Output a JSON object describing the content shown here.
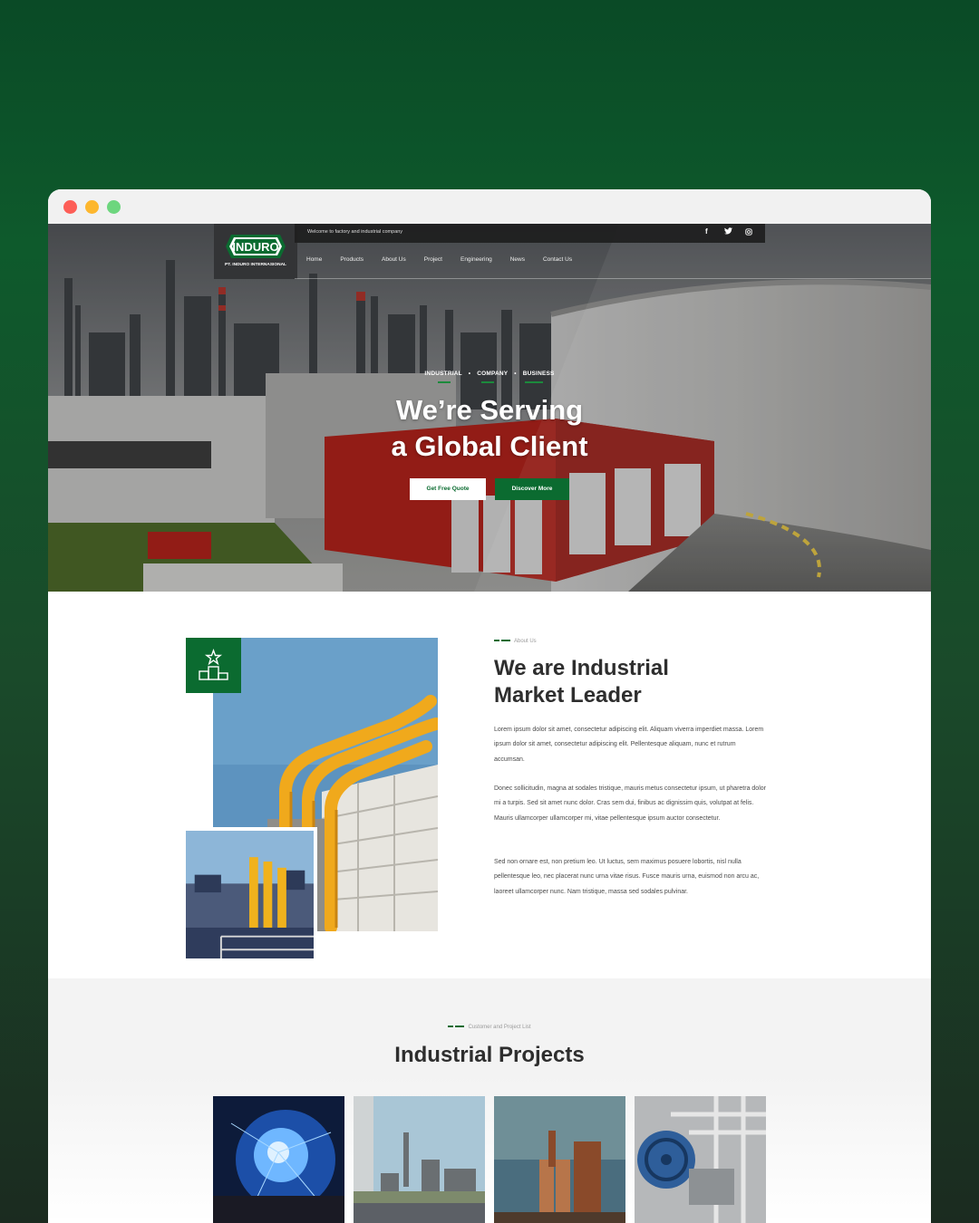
{
  "browser": {
    "controls": [
      "close",
      "minimize",
      "maximize"
    ]
  },
  "topbar": {
    "welcome": "Welcome to factory and industrial company",
    "social": [
      {
        "icon": "facebook-icon",
        "glyph": "f"
      },
      {
        "icon": "twitter-icon",
        "glyph": "🐦"
      },
      {
        "icon": "instagram-icon",
        "glyph": "◎"
      }
    ]
  },
  "logo": {
    "name": "INDURO",
    "company": "PT. INDURO INTERNASIONAL"
  },
  "nav": {
    "items": [
      "Home",
      "Products",
      "About Us",
      "Project",
      "Engineering",
      "News",
      "Contact Us"
    ]
  },
  "hero": {
    "tags": [
      "INDUSTRIAL",
      "COMPANY",
      "BUSINESS"
    ],
    "tag_separator": "•",
    "title_line1": "We’re Serving",
    "title_line2": "a Global Client",
    "btn_quote": "Get Free Quote",
    "btn_discover": "Discover More"
  },
  "about": {
    "kicker": "About Us",
    "title_line1": "We are Industrial",
    "title_line2": "Market Leader",
    "paragraphs": [
      "Lorem ipsum dolor sit amet, consectetur adipiscing elit. Aliquam viverra imperdiet massa. Lorem ipsum dolor sit amet, consectetur adipiscing elit. Pellentesque aliquam, nunc et rutrum accumsan.",
      "Donec sollicitudin, magna at sodales tristique, mauris metus consectetur ipsum, ut pharetra dolor mi a turpis. Sed sit amet nunc dolor. Cras sem dui, finibus ac dignissim quis, volutpat at felis. Mauris ullamcorper ullamcorper mi, vitae pellentesque ipsum auctor consectetur.",
      "Sed non ornare est, non pretium leo. Ut luctus, sem maximus posuere lobortis, nisl nulla pellentesque leo, nec placerat nunc urna vitae risus. Fusce mauris urna, euismod non arcu ac, laoreet ullamcorper nunc. Nam tristique, massa sed sodales pulvinar."
    ],
    "badge_icon": "podium-star-icon"
  },
  "projects": {
    "kicker": "Customer and Project List",
    "title": "Industrial Projects"
  },
  "colors": {
    "brand_green": "#0b6b30",
    "dark": "#333436",
    "accent_line": "#1c8a3c"
  }
}
